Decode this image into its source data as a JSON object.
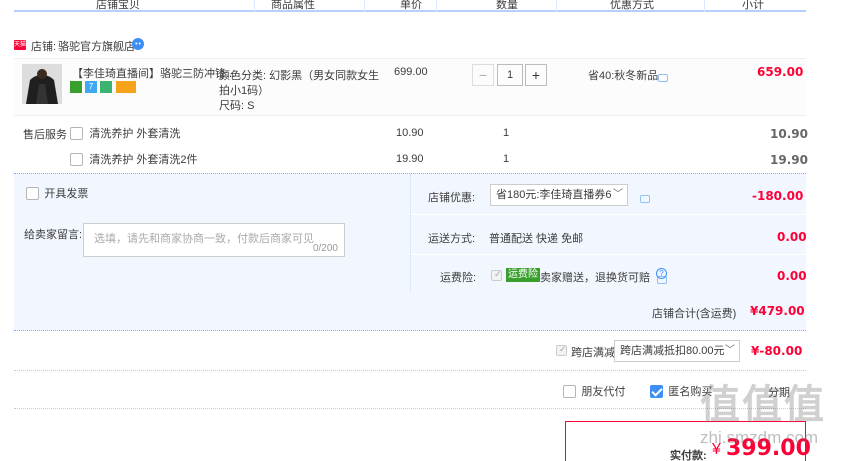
{
  "columns": [
    "店铺宝贝",
    "商品属性",
    "单价",
    "数量",
    "优惠方式",
    "小计"
  ],
  "shop": {
    "badge": "天猫",
    "label": "店铺:",
    "name": "骆驼官方旗舰店"
  },
  "product": {
    "title": "【李佳琦直播间】骆驼三防冲锋...",
    "attr_line1": "颜色分类: 幻影黑（男女同款女生",
    "attr_line2": "拍小1码）",
    "attr_line3": "尺码: S",
    "unit_price": "699.00",
    "quantity": "1",
    "discount": "省40:秋冬新品",
    "subtotal": "659.00"
  },
  "after_sale": {
    "label": "售后服务",
    "items": [
      {
        "name": "清洗养护 外套清洗",
        "price": "10.90",
        "qty": "1",
        "subtotal": "10.90"
      },
      {
        "name": "清洗养护 外套清洗2件",
        "price": "19.90",
        "qty": "1",
        "subtotal": "19.90"
      }
    ]
  },
  "invoice_label": "开具发票",
  "message": {
    "label": "给卖家留言:",
    "placeholder": "选填，请先和商家协商一致，付款后商家可见",
    "count": "0/200"
  },
  "shop_discount": {
    "label": "店铺优惠:",
    "value": "省180元:李佳琦直播券6",
    "amount": "-180.00"
  },
  "shipping": {
    "label": "运送方式:",
    "value": "普通配送 快递 免邮",
    "amount": "0.00"
  },
  "insurance": {
    "label": "运费险:",
    "tag": "运费险",
    "text": "卖家赠送，退换货可赔",
    "amount": "0.00"
  },
  "shop_total": {
    "label": "店铺合计(含运费)",
    "amount": "¥479.00"
  },
  "cross_store": {
    "label": "跨店满减",
    "value": "跨店满减抵扣80.00元",
    "amount": "¥-80.00"
  },
  "options": {
    "friend_pay": "朋友代付",
    "anonymous": "匿名购买",
    "stage": "分期"
  },
  "payment": {
    "label": "实付款:",
    "currency": "¥",
    "amount": "399.00"
  },
  "watermark": {
    "text": "值值值",
    "url": "zhi.smzdm.com"
  },
  "colors": {
    "accent": "#3e8ef7",
    "price": "#ff0036",
    "panel": "#f2f7ff",
    "header_line": "#b2d1ff"
  }
}
